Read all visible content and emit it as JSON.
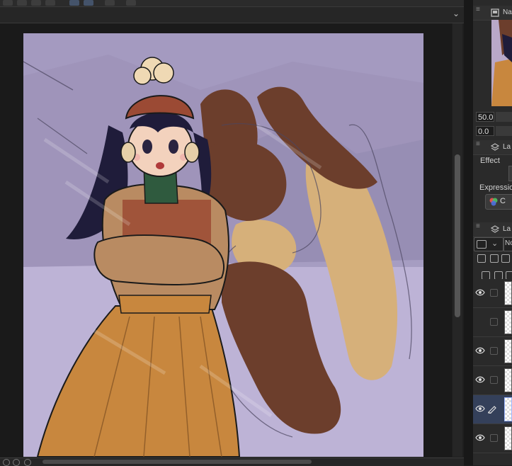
{
  "canvas": {
    "colors": {
      "background": "#a79cc0",
      "skirt": "#c8873e",
      "jacket": "#b98b62",
      "hair": "#1f1c3a",
      "hat": "#9b4a34",
      "scarf": "#2f5a3e",
      "creature_dark": "#6c3e2c",
      "creature_light": "#d6b07a"
    }
  },
  "navigator": {
    "zoom_value": "50.0",
    "angle_value": "0.0"
  },
  "panels": {
    "navigator_title": "Na",
    "layer_property_title": "La",
    "layers_title": "La"
  },
  "layer_property": {
    "effect_label": "Effect",
    "expression_label": "Expression",
    "expression_button": "C"
  },
  "layers_toolbar": {
    "blend_mode": "No"
  },
  "layers": [
    {
      "visible": true,
      "editing": false,
      "selected": false
    },
    {
      "visible": false,
      "editing": false,
      "selected": false
    },
    {
      "visible": true,
      "editing": false,
      "selected": false
    },
    {
      "visible": true,
      "editing": false,
      "selected": false
    },
    {
      "visible": true,
      "editing": true,
      "selected": true
    },
    {
      "visible": true,
      "editing": false,
      "selected": false
    }
  ],
  "icons": {
    "eye": "eye-icon",
    "pen": "pen-icon",
    "grip": "grip-icon",
    "chevron": "chevron-down-icon"
  }
}
